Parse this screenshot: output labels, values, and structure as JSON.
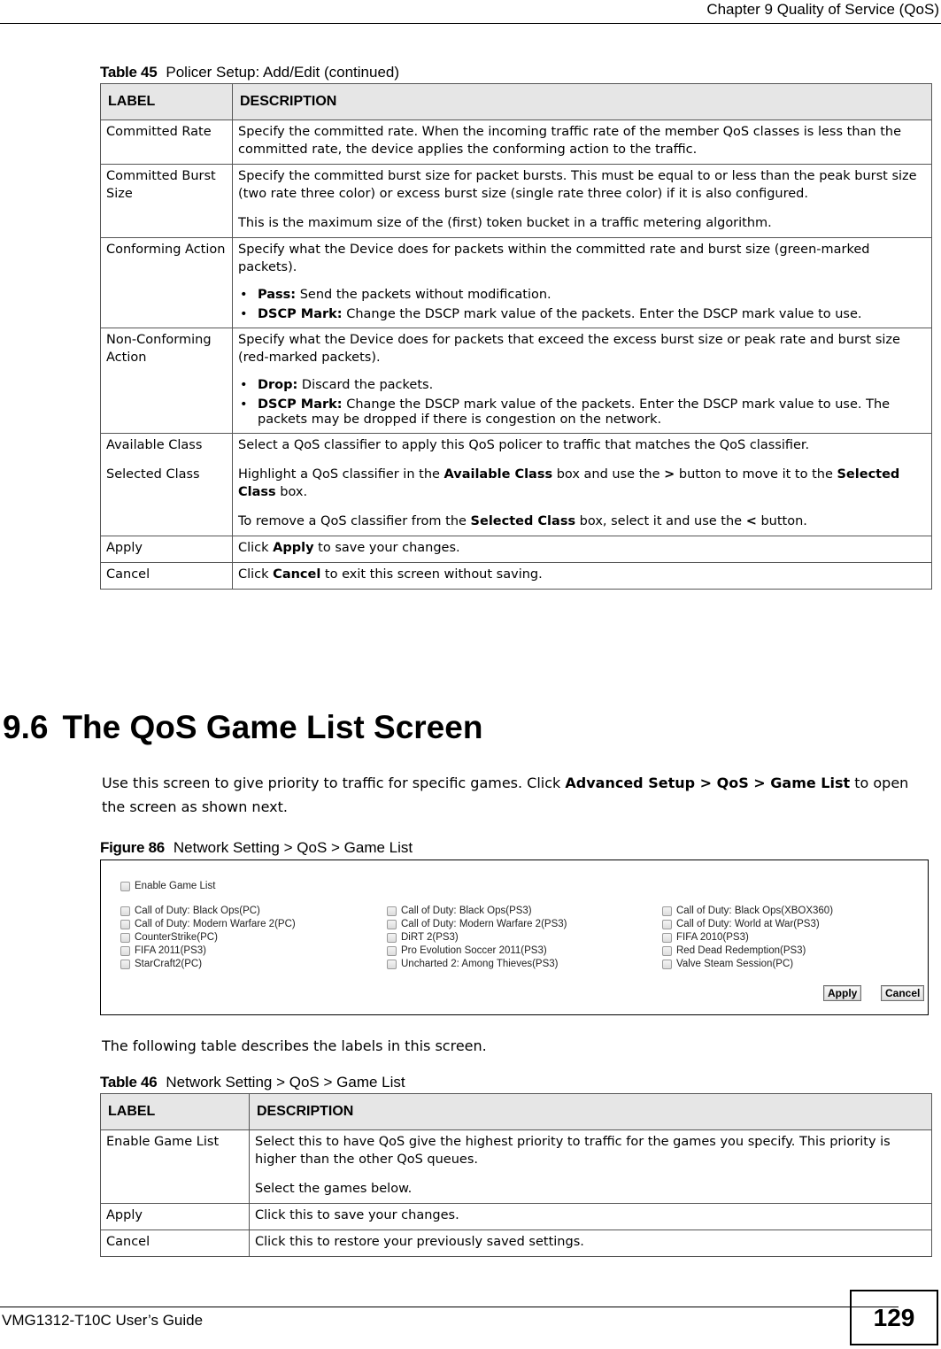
{
  "header": {
    "running_head": "Chapter 9 Quality of Service (QoS)"
  },
  "table45": {
    "caption_num": "Table 45",
    "caption_text": "Policer Setup: Add/Edit (continued)",
    "col_label": "LABEL",
    "col_desc": "DESCRIPTION",
    "rows": [
      {
        "label": "Committed Rate",
        "desc": "Specify the committed rate. When the incoming traffic rate of the member QoS classes is less than the committed rate, the device applies the conforming action to the traffic."
      },
      {
        "label": "Committed Burst Size",
        "desc": "Specify the committed burst size for packet bursts. This must be equal to or less than the peak burst size (two rate three color) or excess burst size (single rate three color) if it is also configured.",
        "desc2": "This is the maximum size of the (first) token bucket in a traffic metering algorithm."
      },
      {
        "label": "Conforming Action",
        "desc": "Specify what the Device does for packets within the committed rate and burst size (green-marked packets).",
        "bullets": [
          {
            "bold": "Pass:",
            "text": " Send the packets without modification."
          },
          {
            "bold": "DSCP Mark:",
            "text": " Change the DSCP mark value of the packets. Enter the DSCP mark value to use."
          }
        ]
      },
      {
        "label": "Non-Conforming Action",
        "desc": "Specify what the Device does for packets that exceed the excess burst size or peak rate and burst size (red-marked packets).",
        "bullets": [
          {
            "bold": "Drop:",
            "text": " Discard the packets."
          },
          {
            "bold": "DSCP Mark:",
            "text": " Change the DSCP mark value of the packets. Enter the DSCP mark value to use. The packets may be dropped if there is congestion on the network."
          }
        ]
      },
      {
        "label": "Available Class",
        "label2": "Selected Class",
        "desc": "Select a QoS classifier to apply this QoS policer to traffic that matches the QoS classifier.",
        "desc2_parts": [
          "Highlight a QoS classifier in the ",
          "Available Class",
          " box and use the ",
          ">",
          " button to move it to the ",
          "Selected Class",
          " box."
        ],
        "desc3_parts": [
          "To remove a QoS classifier from the ",
          "Selected Class",
          " box, select it and use the ",
          "<",
          " button."
        ]
      },
      {
        "label": "Apply",
        "desc_parts": [
          "Click ",
          "Apply",
          " to save your changes."
        ]
      },
      {
        "label": "Cancel",
        "desc_parts": [
          "Click ",
          "Cancel",
          " to exit this screen without saving."
        ]
      }
    ]
  },
  "section": {
    "number": "9.6",
    "title": "The QoS Game List Screen",
    "intro_parts": [
      "Use this screen to give priority to traffic for specific games. Click ",
      "Advanced Setup > QoS > Game List",
      " to open the screen as shown next."
    ]
  },
  "figure86": {
    "caption_num": "Figure 86",
    "caption_text": "Network Setting > QoS > Game List",
    "enable_label": "Enable Game List",
    "enable_checked": false,
    "columns": [
      [
        {
          "label": "Call of Duty: Black Ops(PC)",
          "checked": false
        },
        {
          "label": "Call of Duty: Modern Warfare 2(PC)",
          "checked": false
        },
        {
          "label": "CounterStrike(PC)",
          "checked": false
        },
        {
          "label": "FIFA 2011(PS3)",
          "checked": false
        },
        {
          "label": "StarCraft2(PC)",
          "checked": false
        }
      ],
      [
        {
          "label": "Call of Duty: Black Ops(PS3)",
          "checked": false
        },
        {
          "label": "Call of Duty: Modern Warfare 2(PS3)",
          "checked": false
        },
        {
          "label": "DiRT 2(PS3)",
          "checked": false
        },
        {
          "label": "Pro Evolution Soccer 2011(PS3)",
          "checked": false
        },
        {
          "label": "Uncharted 2: Among Thieves(PS3)",
          "checked": false
        }
      ],
      [
        {
          "label": "Call of Duty: Black Ops(XBOX360)",
          "checked": false
        },
        {
          "label": "Call of Duty: World at War(PS3)",
          "checked": false
        },
        {
          "label": "FIFA 2010(PS3)",
          "checked": false
        },
        {
          "label": "Red Dead Redemption(PS3)",
          "checked": false
        },
        {
          "label": "Valve Steam Session(PC)",
          "checked": false
        }
      ]
    ],
    "apply_label": "Apply",
    "cancel_label": "Cancel"
  },
  "following_text": "The following table describes the labels in this screen.",
  "table46": {
    "caption_num": "Table 46",
    "caption_text": "Network Setting > QoS > Game List",
    "col_label": "LABEL",
    "col_desc": "DESCRIPTION",
    "rows": [
      {
        "label": "Enable Game List",
        "desc": "Select this to have QoS give the highest priority to traffic for the games you specify. This priority is higher than the other QoS queues.",
        "desc2": "Select the games below."
      },
      {
        "label": "Apply",
        "desc": "Click this to save your changes."
      },
      {
        "label": "Cancel",
        "desc": "Click this to restore your previously saved settings."
      }
    ]
  },
  "footer": {
    "guide_title": "VMG1312-T10C User’s Guide",
    "page_number": "129"
  }
}
